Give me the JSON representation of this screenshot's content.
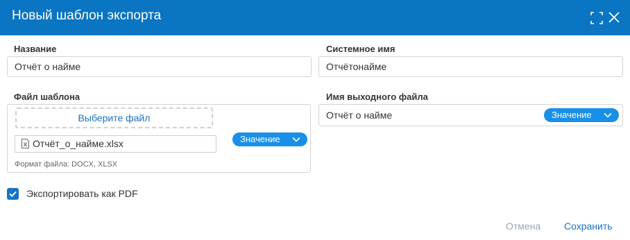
{
  "dialog": {
    "title": "Новый шаблон экспорта"
  },
  "fields": {
    "name": {
      "label": "Название",
      "value": "Отчёт о найме"
    },
    "system_name": {
      "label": "Системное имя",
      "value": "Отчётонайме"
    },
    "template_file": {
      "label": "Файл шаблона",
      "choose_label": "Выберите файл",
      "file_name": "Отчёт_о_найме.xlsx",
      "format_hint": "Формат файла: DOCX, XLSX",
      "value_button": "Значение"
    },
    "output_file": {
      "label": "Имя выходного файла",
      "value": "Отчёт о найме",
      "value_button": "Значение"
    }
  },
  "export_pdf": {
    "label": "Экспортировать как PDF",
    "checked": true
  },
  "footer": {
    "cancel_label": "Отмена",
    "save_label": "Сохранить"
  },
  "icons": {
    "maximize": "maximize-icon",
    "close": "close-icon",
    "file": "excel-file-icon",
    "chevron": "chevron-down-icon",
    "check": "check-icon"
  },
  "colors": {
    "titlebar": "#0a75c2",
    "accent": "#1a73c4",
    "value_button": "#1a8fe8",
    "cancel_text": "#9aa7b3"
  }
}
